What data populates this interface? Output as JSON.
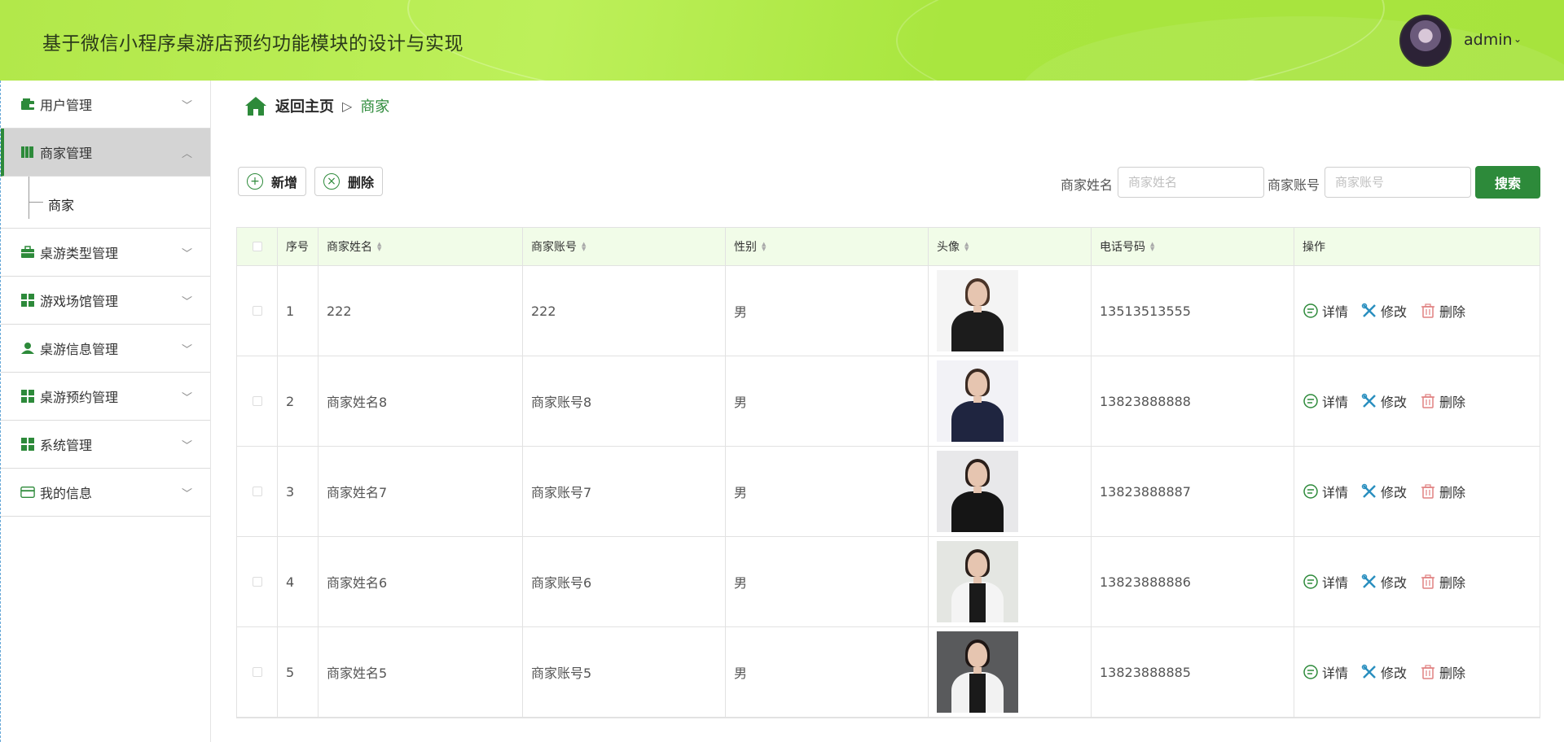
{
  "app": {
    "title": "基于微信小程序桌游店预约功能模块的设计与实现"
  },
  "user": {
    "name": "admin",
    "chevron": "⌄"
  },
  "sidebar": {
    "items": [
      {
        "label": "用户管理",
        "icon": "wallet-icon",
        "expanded": false
      },
      {
        "label": "商家管理",
        "icon": "book-icon",
        "expanded": true,
        "active": true,
        "children": [
          {
            "label": "商家"
          }
        ]
      },
      {
        "label": "桌游类型管理",
        "icon": "briefcase-icon",
        "expanded": false
      },
      {
        "label": "游戏场馆管理",
        "icon": "grid-icon",
        "expanded": false
      },
      {
        "label": "桌游信息管理",
        "icon": "person-icon",
        "expanded": false
      },
      {
        "label": "桌游预约管理",
        "icon": "grid-icon",
        "expanded": false
      },
      {
        "label": "系统管理",
        "icon": "grid-icon",
        "expanded": false
      },
      {
        "label": "我的信息",
        "icon": "card-icon",
        "expanded": false
      }
    ]
  },
  "breadcrumb": {
    "home": "返回主页",
    "separator": "▷",
    "current": "商家"
  },
  "toolbar": {
    "add_label": "新增",
    "delete_label": "删除"
  },
  "search": {
    "name_label": "商家姓名",
    "name_placeholder": "商家姓名",
    "name_value": "",
    "account_label": "商家账号",
    "account_placeholder": "商家账号",
    "account_value": "",
    "button_label": "搜索"
  },
  "table": {
    "columns": [
      "",
      "序号",
      "商家姓名",
      "商家账号",
      "性别",
      "头像",
      "电话号码",
      "操作"
    ],
    "actions": {
      "detail": "详情",
      "edit": "修改",
      "delete": "删除"
    },
    "rows": [
      {
        "index": "1",
        "name": "222",
        "account": "222",
        "gender": "男",
        "phone": "13513513555",
        "avatar": "black-tshirt"
      },
      {
        "index": "2",
        "name": "商家姓名8",
        "account": "商家账号8",
        "gender": "男",
        "phone": "13823888888",
        "avatar": "navy-polo"
      },
      {
        "index": "3",
        "name": "商家姓名7",
        "account": "商家账号7",
        "gender": "男",
        "phone": "13823888887",
        "avatar": "black-suit"
      },
      {
        "index": "4",
        "name": "商家姓名6",
        "account": "商家账号6",
        "gender": "男",
        "phone": "13823888886",
        "avatar": "white-black-vest"
      },
      {
        "index": "5",
        "name": "商家姓名5",
        "account": "商家账号5",
        "gender": "男",
        "phone": "13823888885",
        "avatar": "white-blazer"
      }
    ]
  },
  "colors": {
    "brand": "#2d8a3a",
    "header": "#b2e84a",
    "table_header": "#f1fce8"
  }
}
